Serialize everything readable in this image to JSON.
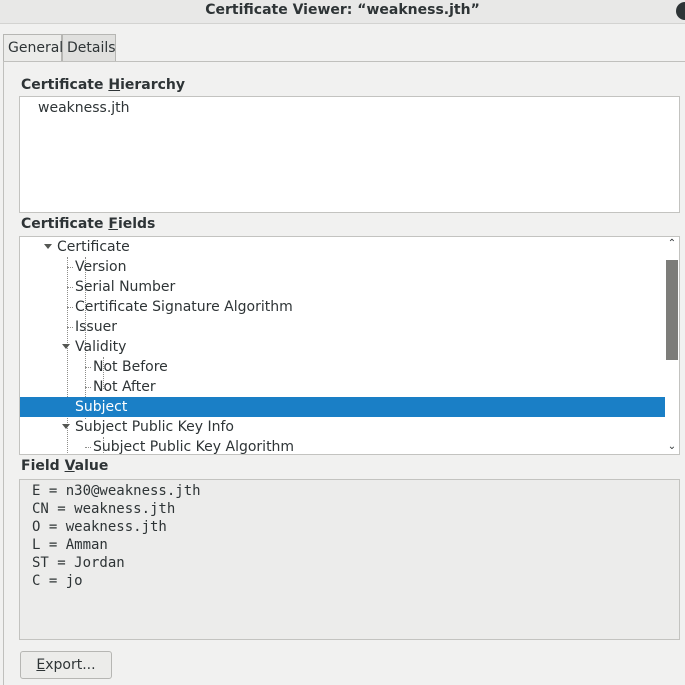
{
  "window": {
    "title": "Certificate Viewer: “weakness.jth”"
  },
  "tabs": [
    {
      "label": "General",
      "selected": false
    },
    {
      "label": "Details",
      "selected": true
    }
  ],
  "hierarchy": {
    "label_pre": "Certificate ",
    "label_mnemonic": "H",
    "label_post": "ierarchy",
    "items": [
      "weakness.jth"
    ]
  },
  "fields": {
    "label_pre": "Certificate ",
    "label_mnemonic": "F",
    "label_post": "ields",
    "tree": [
      {
        "label": "Certificate",
        "expanded": true
      },
      {
        "label": "Version"
      },
      {
        "label": "Serial Number"
      },
      {
        "label": "Certificate Signature Algorithm"
      },
      {
        "label": "Issuer"
      },
      {
        "label": "Validity",
        "expanded": true
      },
      {
        "label": "Not Before"
      },
      {
        "label": "Not After"
      },
      {
        "label": "Subject",
        "selected": true
      },
      {
        "label": "Subject Public Key Info",
        "expanded": true
      },
      {
        "label": "Subject Public Key Algorithm"
      }
    ]
  },
  "field_value": {
    "label_pre": "Field ",
    "label_mnemonic": "V",
    "label_post": "alue",
    "lines": [
      "E = n30@weakness.jth",
      "CN = weakness.jth",
      "O = weakness.jth",
      "L = Amman",
      "ST = Jordan",
      "C = jo"
    ]
  },
  "export_button": {
    "label_mnemonic": "E",
    "label_post": "xport..."
  },
  "colors": {
    "selection": "#1a7fc6",
    "window_bg": "#f1f1f0"
  }
}
